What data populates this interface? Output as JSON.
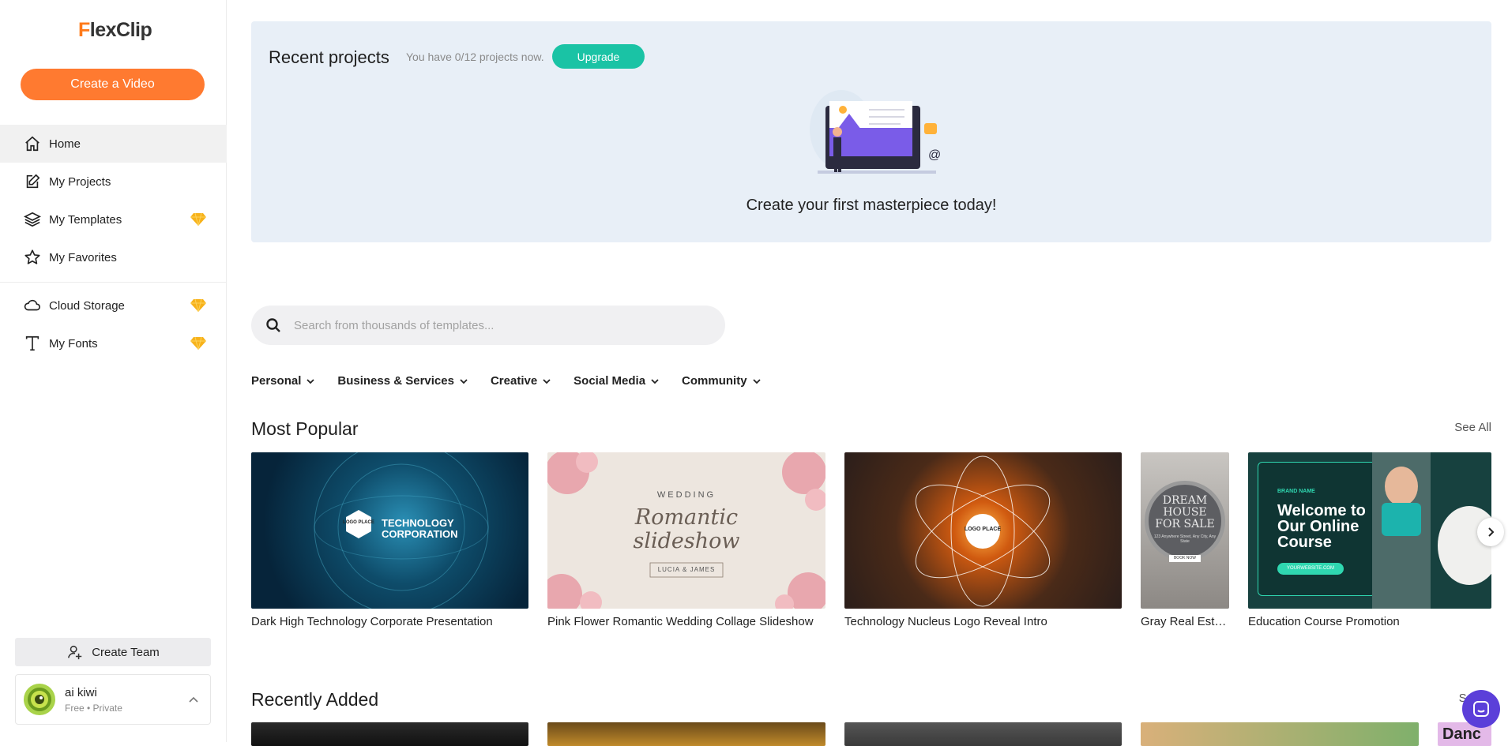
{
  "brand": {
    "logo_first": "F",
    "logo_rest": "lexClip"
  },
  "sidebar": {
    "create_label": "Create a Video",
    "items": [
      {
        "label": "Home",
        "icon": "home-icon",
        "active": true
      },
      {
        "label": "My Projects",
        "icon": "edit-icon"
      },
      {
        "label": "My Templates",
        "icon": "layers-icon",
        "premium": true
      },
      {
        "label": "My Favorites",
        "icon": "star-icon"
      },
      {
        "label": "Cloud Storage",
        "icon": "cloud-icon",
        "premium": true
      },
      {
        "label": "My Fonts",
        "icon": "font-icon",
        "premium": true
      }
    ],
    "create_team_label": "Create Team",
    "user": {
      "name": "ai kiwi",
      "plan": "Free • Private"
    }
  },
  "recent": {
    "title": "Recent projects",
    "count_text": "You have 0/12 projects now.",
    "upgrade_label": "Upgrade",
    "empty_text": "Create your first masterpiece today!"
  },
  "search": {
    "placeholder": "Search from thousands of templates..."
  },
  "categories": [
    "Personal",
    "Business & Services",
    "Creative",
    "Social Media",
    "Community"
  ],
  "most_popular": {
    "title": "Most Popular",
    "see_all": "See All",
    "cards": [
      {
        "caption": "Dark High Technology Corporate Presentation",
        "thumb_text": "TECHNOLOGY CORPORATION",
        "logo_text": "LOGO PLACE"
      },
      {
        "caption": "Pink Flower Romantic Wedding Collage Slideshow",
        "thumb_top": "WEDDING",
        "thumb_script": "Romantic slideshow",
        "thumb_names": "LUCIA & JAMES"
      },
      {
        "caption": "Technology Nucleus Logo Reveal Intro",
        "logo_text": "LOGO PLACE"
      },
      {
        "caption": "Gray Real Estat...",
        "thumb_text": "DREAM HOUSE FOR SALE",
        "thumb_small": "123 Anywhere Street, Any City, Any State",
        "thumb_btn": "BOOK NOW"
      },
      {
        "caption": "Education Course Promotion",
        "thumb_brand": "BRAND NAME",
        "thumb_text": "Welcome to Our Online Course",
        "thumb_url": "YOURWEBSITE.COM"
      }
    ]
  },
  "recently_added": {
    "title": "Recently Added",
    "see_all": "Se",
    "partial_text": "Danc"
  },
  "colors": {
    "accent_orange": "#ff7a30",
    "accent_teal": "#1ac3a5",
    "premium_gold": "#f7b21a",
    "chat_purple": "#5b3fd9"
  }
}
